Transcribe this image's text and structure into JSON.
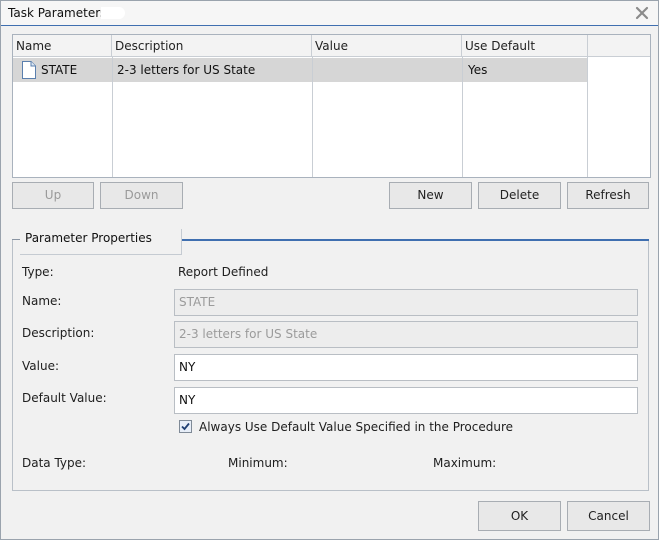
{
  "window": {
    "title": "Task Parameters",
    "close_icon": "close-icon"
  },
  "grid": {
    "columns": [
      "Name",
      "Description",
      "Value",
      "Use Default"
    ],
    "rows": [
      {
        "icon": "document-icon",
        "name": "STATE",
        "description": "2-3 letters for US State",
        "value": "",
        "use_default": "Yes"
      }
    ]
  },
  "actions": {
    "up": "Up",
    "down": "Down",
    "new": "New",
    "delete": "Delete",
    "refresh": "Refresh"
  },
  "properties": {
    "legend": "Parameter Properties",
    "type_label": "Type:",
    "type_value": "Report Defined",
    "name_label": "Name:",
    "name_value": "STATE",
    "description_label": "Description:",
    "description_value": "2-3 letters for US State",
    "value_label": "Value:",
    "value_value": "NY",
    "default_label": "Default Value:",
    "default_value": "NY",
    "always_default_label": "Always Use Default Value Specified in the Procedure",
    "always_default_checked": true,
    "data_type_label": "Data Type:",
    "minimum_label": "Minimum:",
    "maximum_label": "Maximum:"
  },
  "footer": {
    "ok": "OK",
    "cancel": "Cancel"
  },
  "colors": {
    "accent": "#3f6fb0",
    "selected_row": "#d6d6d6",
    "dialog_bg": "#f1f1f1"
  }
}
